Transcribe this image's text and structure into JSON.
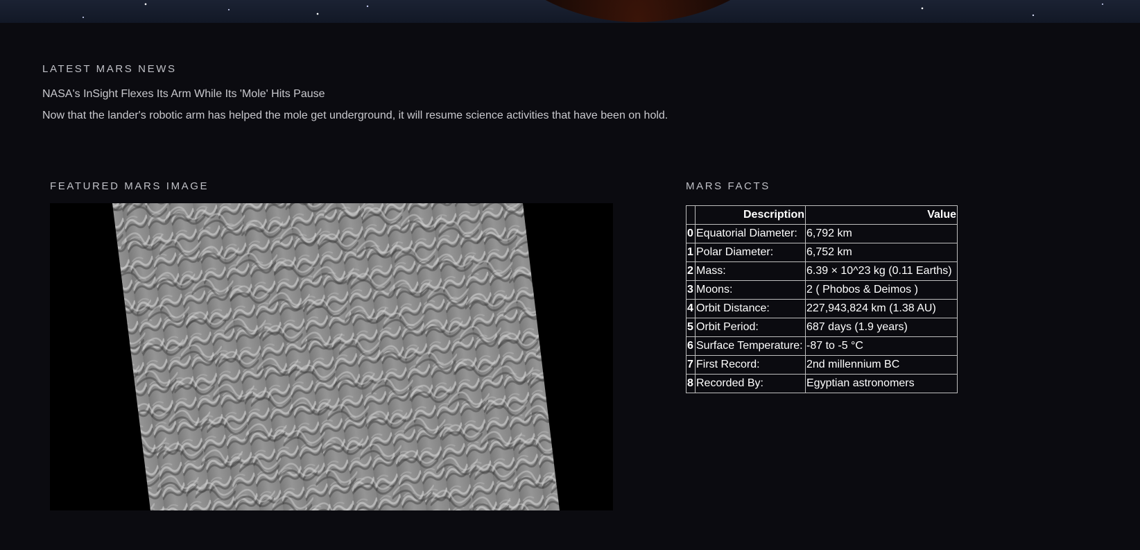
{
  "news": {
    "section_title": "LATEST MARS NEWS",
    "headline": "NASA's InSight Flexes Its Arm While Its 'Mole' Hits Pause",
    "teaser": "Now that the lander's robotic arm has helped the mole get underground, it will resume science activities that have been on hold."
  },
  "featured": {
    "section_title": "FEATURED MARS IMAGE"
  },
  "facts": {
    "section_title": "MARS FACTS",
    "columns": [
      "",
      "Description",
      "Value"
    ],
    "rows": [
      {
        "index": "0",
        "description": "Equatorial Diameter:",
        "value": "6,792 km"
      },
      {
        "index": "1",
        "description": "Polar Diameter:",
        "value": "6,752 km"
      },
      {
        "index": "2",
        "description": "Mass:",
        "value": "6.39 × 10^23 kg (0.11 Earths)"
      },
      {
        "index": "3",
        "description": "Moons:",
        "value": "2 ( Phobos & Deimos )"
      },
      {
        "index": "4",
        "description": "Orbit Distance:",
        "value": "227,943,824 km (1.38 AU)"
      },
      {
        "index": "5",
        "description": "Orbit Period:",
        "value": "687 days (1.9 years)"
      },
      {
        "index": "6",
        "description": "Surface Temperature:",
        "value": "-87 to -5 °C"
      },
      {
        "index": "7",
        "description": "First Record:",
        "value": "2nd millennium BC"
      },
      {
        "index": "8",
        "description": "Recorded By:",
        "value": "Egyptian astronomers"
      }
    ]
  },
  "colors": {
    "background": "#0b0b10",
    "text": "#c9c9ce",
    "table_border": "#bfbfbf"
  }
}
